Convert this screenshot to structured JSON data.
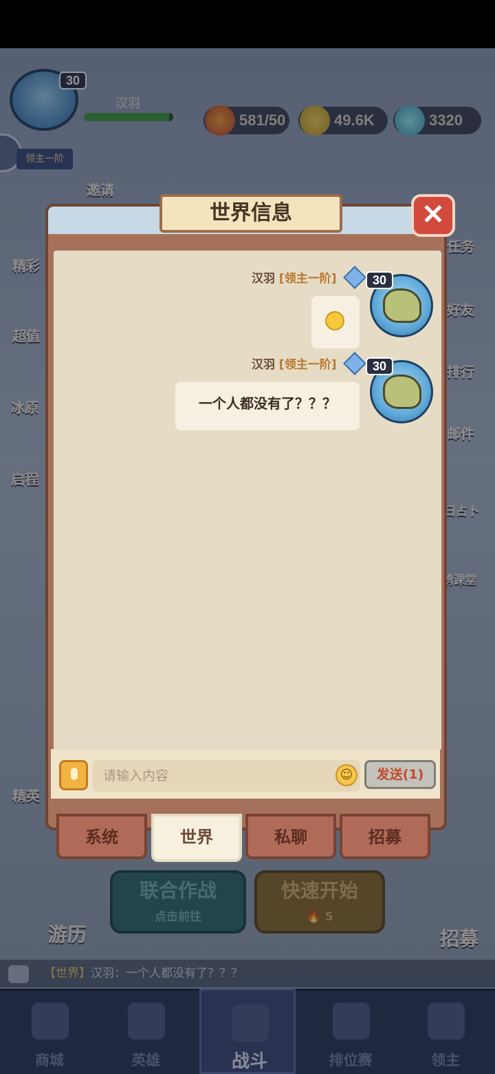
{
  "hud": {
    "player_name": "汉羽",
    "level": "30",
    "rank_tag": "领主一阶",
    "hp_fraction": 0.95,
    "energy": "581/50",
    "gold": "49.6K",
    "gems": "3320",
    "invite_label": "邀请"
  },
  "side_left": [
    "精彩",
    "超值",
    "冰原",
    "启程",
    "精英"
  ],
  "side_right": [
    "任务",
    "好友",
    "排行",
    "邮件",
    "日占卜",
    "鹅课堂"
  ],
  "modal": {
    "title": "世界信息",
    "close_symbol": "✕"
  },
  "messages": [
    {
      "sender": "汉羽",
      "rank": "[领主一阶]",
      "level": "30",
      "text": "",
      "emoji": "flushed-face"
    },
    {
      "sender": "汉羽",
      "rank": "[领主一阶]",
      "level": "30",
      "text": "一个人都没有了？？？"
    }
  ],
  "input": {
    "placeholder": "请输入内容",
    "send_label": "发送(1)"
  },
  "tabs": [
    {
      "label": "系统",
      "active": false
    },
    {
      "label": "世界",
      "active": true
    },
    {
      "label": "私聊",
      "active": false
    },
    {
      "label": "招募",
      "active": false
    }
  ],
  "bottom": {
    "travel_label": "游历",
    "coop_title": "联合作战",
    "coop_sub": "点击前往",
    "quick_title": "快速开始",
    "quick_cost": "5",
    "recruit_label": "招募"
  },
  "ticker": {
    "tag": "【世界】",
    "text": "汉羽：一个人都没有了？？？"
  },
  "nav": [
    {
      "label": "商城",
      "active": false
    },
    {
      "label": "英雄",
      "active": false
    },
    {
      "label": "战斗",
      "active": true
    },
    {
      "label": "排位赛",
      "active": false
    },
    {
      "label": "领主",
      "active": false
    }
  ],
  "colors": {
    "modal_frame": "#a5715a",
    "chat_bg": "#e6dcc6",
    "close_red": "#d24a3d",
    "rank_gold": "#b8782f"
  }
}
